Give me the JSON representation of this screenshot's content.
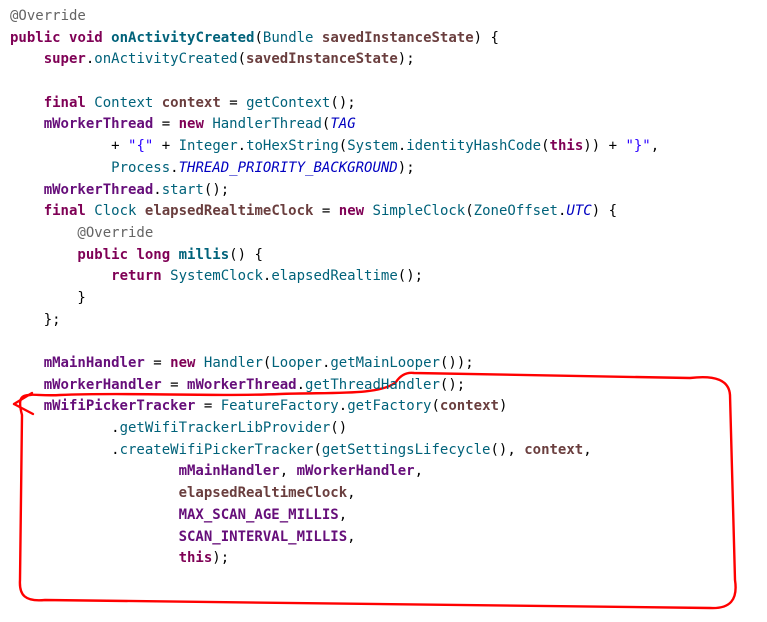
{
  "annotation_override": "@Override",
  "kw_public": "public",
  "kw_void": "void",
  "kw_final": "final",
  "kw_new": "new",
  "kw_return": "return",
  "kw_long": "long",
  "kw_super": "super",
  "kw_this": "this",
  "decl_onActivityCreated": "onActivityCreated",
  "type_Bundle": "Bundle",
  "param_savedInstanceState": "savedInstanceState",
  "call_onActivityCreated": "onActivityCreated",
  "type_Context": "Context",
  "var_context": "context",
  "call_getContext": "getContext",
  "fld_mWorkerThread": "mWorkerThread",
  "type_HandlerThread": "HandlerThread",
  "const_TAG": "TAG",
  "str_openBrace": "\"{\"",
  "type_Integer": "Integer",
  "call_toHexString": "toHexString",
  "type_System": "System",
  "call_identityHashCode": "identityHashCode",
  "str_closeBrace": "\"}\"",
  "type_Process": "Process",
  "const_THREAD_PRIORITY_BACKGROUND": "THREAD_PRIORITY_BACKGROUND",
  "call_start": "start",
  "type_Clock": "Clock",
  "var_elapsedRealtimeClock": "elapsedRealtimeClock",
  "type_SimpleClock": "SimpleClock",
  "type_ZoneOffset": "ZoneOffset",
  "const_UTC": "UTC",
  "decl_millis": "millis",
  "type_SystemClock": "SystemClock",
  "call_elapsedRealtime": "elapsedRealtime",
  "fld_mMainHandler": "mMainHandler",
  "type_Handler": "Handler",
  "type_Looper": "Looper",
  "call_getMainLooper": "getMainLooper",
  "fld_mWorkerHandler": "mWorkerHandler",
  "call_getThreadHandler": "getThreadHandler",
  "fld_mWifiPickerTracker": "mWifiPickerTracker",
  "type_FeatureFactory": "FeatureFactory",
  "call_getFactory": "getFactory",
  "call_getWifiTrackerLibProvider": "getWifiTrackerLibProvider",
  "call_createWifiPickerTracker": "createWifiPickerTracker",
  "call_getSettingsLifecycle": "getSettingsLifecycle",
  "const_MAX_SCAN_AGE_MILLIS": "MAX_SCAN_AGE_MILLIS",
  "const_SCAN_INTERVAL_MILLIS": "SCAN_INTERVAL_MILLIS",
  "punc": {
    "lp": "(",
    "rp": ")",
    "lb": "{",
    "rb": "}",
    "semi": ";",
    "dot": ".",
    "comma": ",",
    "plus": "+",
    "eq": "="
  }
}
